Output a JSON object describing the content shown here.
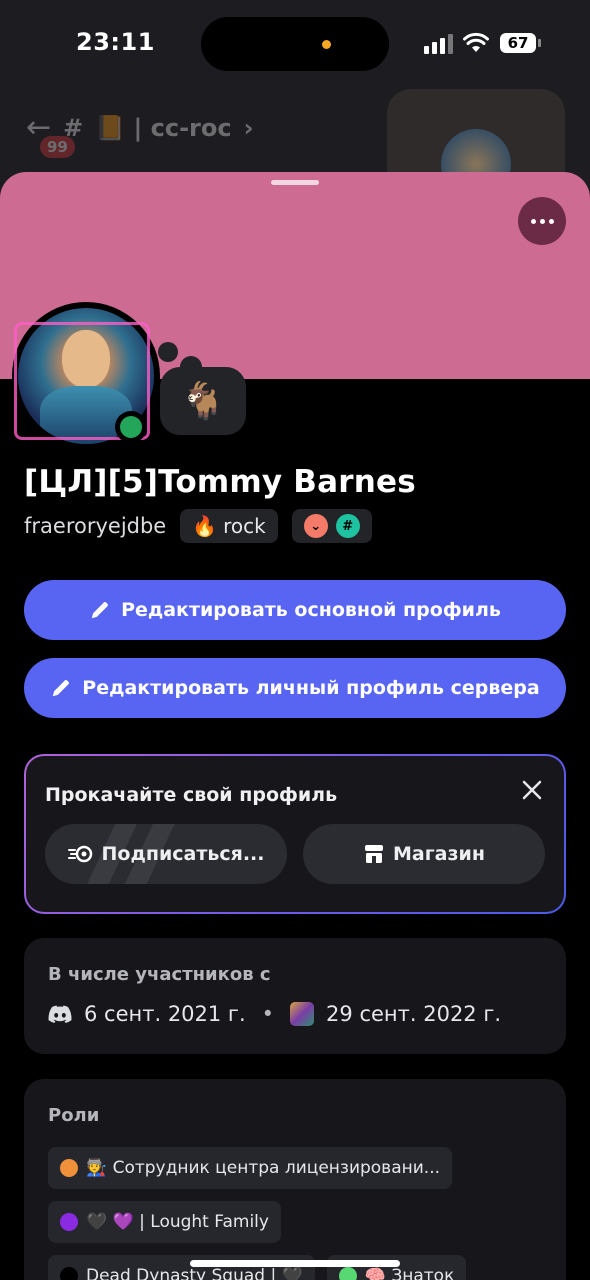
{
  "status_bar": {
    "time": "23:11",
    "battery": "67"
  },
  "background_chat": {
    "unread_badge": "99",
    "channel_name": "📙 | cc-roc"
  },
  "profile": {
    "display_name": "[ЦЛ][5]Tommy Barnes",
    "username": "fraeroryejdbe",
    "status_emoji": "🐐",
    "chip_rock_emoji": "🔥",
    "chip_rock_label": "rock",
    "badge_hash": "#"
  },
  "actions": {
    "edit_main_profile": "Редактировать основной профиль",
    "edit_server_profile": "Редактировать личный профиль сервера"
  },
  "upsell": {
    "title": "Прокачайте свой профиль",
    "subscribe_label": "Подписаться...",
    "shop_label": "Магазин"
  },
  "member_since": {
    "label": "В числе участников с",
    "discord_date": "6 сент. 2021 г.",
    "separator": "•",
    "server_date": "29 сент. 2022 г."
  },
  "roles": {
    "label": "Роли",
    "items": [
      {
        "color": "#f0903a",
        "text": "🧑‍🏭 Сотрудник центра лицензировани..."
      },
      {
        "color": "#8a2be2",
        "text": "🖤 💜 | Lought Family"
      },
      {
        "color": "#000000",
        "text": "Dead Dynasty Squad | 🖤"
      },
      {
        "color": "#57d873",
        "text": "🧠 Знаток"
      }
    ]
  },
  "colors": {
    "banner": "#cd6b93",
    "primary": "#5865f2",
    "online": "#23a55a"
  }
}
